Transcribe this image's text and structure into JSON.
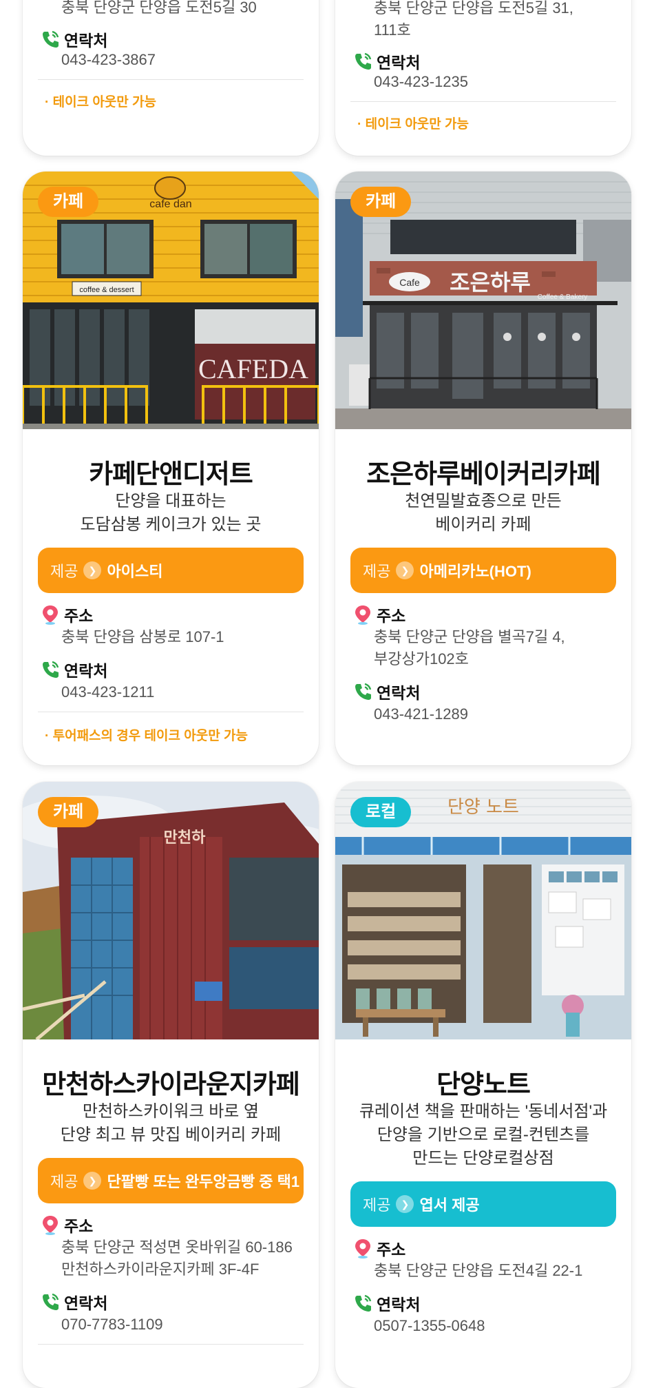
{
  "colors": {
    "orange": "#fb9912",
    "teal": "#17bed0",
    "note": "#f29a0c"
  },
  "top_cards": [
    {
      "address": "충북 단양군 단양읍 도전5길 30",
      "contact_label": "연락처",
      "phone": "043-423-3867",
      "note": "· 테이크 아웃만 가능"
    },
    {
      "address_line1": "충북 단양군 단양읍 도전5길 31,",
      "address_line2": "111호",
      "contact_label": "연락처",
      "phone": "043-423-1235",
      "note": "· 테이크 아웃만 가능"
    }
  ],
  "cards": [
    {
      "badge": "카페",
      "name": "카페단앤디저트",
      "desc_line1": "단양을 대표하는",
      "desc_line2": "도담삼봉 케이크가 있는 곳",
      "offer_label": "제공",
      "offer": "아이스티",
      "address_label": "주소",
      "address_line1": "충북 단양읍 삼봉로 107-1",
      "contact_label": "연락처",
      "phone": "043-423-1211",
      "note": "· 투어패스의 경우 테이크 아웃만 가능",
      "sign_text": "cafe dan",
      "sign2_text": "coffee & dessert"
    },
    {
      "badge": "카페",
      "name": "조은하루베이커리카페",
      "desc_line1": "천연밀발효종으로 만든",
      "desc_line2": "베이커리 카페",
      "offer_label": "제공",
      "offer": "아메리카노(HOT)",
      "address_label": "주소",
      "address_line1": "충북 단양군 단양읍 별곡7길 4,",
      "address_line2": "부강상가102호",
      "contact_label": "연락처",
      "phone": "043-421-1289",
      "sign_text": "조은하루",
      "sign2_text": "Coffee & Bakery"
    },
    {
      "badge": "카페",
      "name": "만천하스카이라운지카페",
      "desc_line1": "만천하스카이워크 바로 옆",
      "desc_line2": "단양 최고 뷰 맛집 베이커리 카페",
      "offer_label": "제공",
      "offer": "단팥빵 또는 완두앙금빵 중 택1",
      "address_label": "주소",
      "address_line1": "충북 단양군 적성면 옷바위길 60-186",
      "address_line2": "만천하스카이라운지카페 3F-4F",
      "contact_label": "연락처",
      "phone": "070-7783-1109",
      "sign_text": "만천하"
    },
    {
      "badge": "로컬",
      "name": "단양노트",
      "desc_line1": "큐레이션 책을 판매하는 '동네서점'과",
      "desc_line2": "단양을 기반으로 로컬-컨텐츠를",
      "desc_line3": "만드는 단양로컬상점",
      "offer_label": "제공",
      "offer": "엽서 제공",
      "address_label": "주소",
      "address_line1": "충북 단양군 단양읍 도전4길 22-1",
      "contact_label": "연락처",
      "phone": "0507-1355-0648",
      "sign_text": "단양 노트"
    }
  ]
}
